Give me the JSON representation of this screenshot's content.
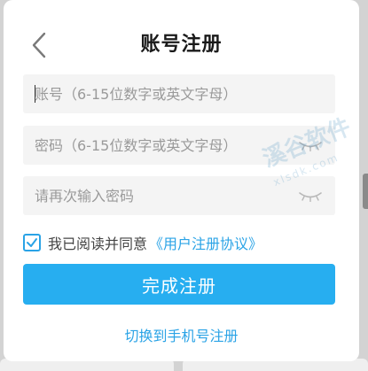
{
  "header": {
    "title": "账号注册"
  },
  "form": {
    "account_placeholder": "账号（6-15位数字或英文字母）",
    "password_placeholder": "密码（6-15位数字或英文字母）",
    "confirm_placeholder": "请再次输入密码"
  },
  "agreement": {
    "checked": true,
    "text": "我已阅读并同意",
    "link": "《用户注册协议》"
  },
  "submit_label": "完成注册",
  "switch_label": "切换到手机号注册",
  "watermark": {
    "text": "溪谷软件",
    "sub": "xlsdk.com"
  },
  "icons": {
    "back": "chevron-left-icon",
    "eye": "eye-closed-icon",
    "check": "check-icon"
  },
  "colors": {
    "accent": "#27aef0",
    "link": "#2aa3e6",
    "field_bg": "#f4f4f4"
  }
}
